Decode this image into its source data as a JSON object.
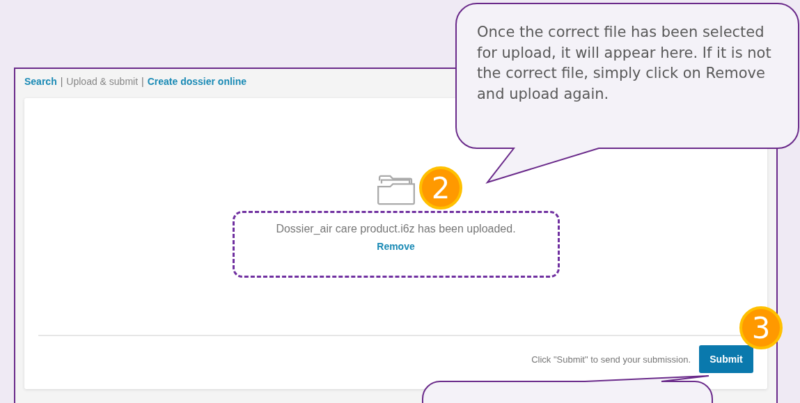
{
  "breadcrumb": {
    "items": [
      {
        "label": "Search",
        "selected": false
      },
      {
        "label": "Upload & submit",
        "selected": true
      },
      {
        "label": "Create dossier online",
        "selected": false
      }
    ],
    "separators": [
      "|",
      "|"
    ]
  },
  "upload": {
    "message": "Dossier_air care product.i6z has been uploaded.",
    "remove_link": "Remove"
  },
  "footer": {
    "hint": "Click \"Submit\" to send your submission.",
    "button": "Submit"
  },
  "badges": [
    {
      "number": "2"
    },
    {
      "number": "3"
    }
  ],
  "callout": {
    "text": "Once the correct file has been selected for upload, it will appear here. If it is not the correct file, simply click on Remove and upload again."
  }
}
